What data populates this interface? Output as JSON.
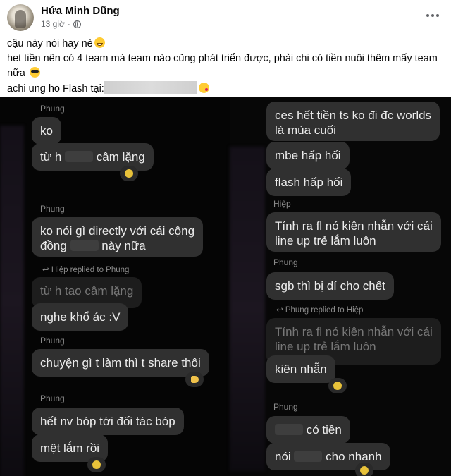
{
  "post": {
    "author": "Hứa Minh Dũng",
    "time": "13 giờ",
    "lines": [
      "cậu này nói hay nè",
      "het tiền nên có 4 team mà team nào cũng phát triển được, phải chi có tiền nuôi thêm mấy team",
      "nữa",
      "achi ung ho Flash tại:"
    ],
    "icons": [
      "globe-icon",
      "more-options-icon",
      "grin-emoji",
      "sunglasses-emoji",
      "kiss-emoji"
    ]
  },
  "chat_left": {
    "s1": "Phung",
    "b1": "ko",
    "b2a": "từ h",
    "b2b": "câm lặng",
    "s2": "Phung",
    "b3l1": "ko nói gì directly với cái cộng",
    "b3l2a": "đồng",
    "b3l2b": "này nữa",
    "reply1": "↩ Hiệp replied to Phung",
    "quote1": "từ h tao câm lặng",
    "b4": "nghe khổ ác :V",
    "s3": "Phung",
    "b5": "chuyện gì t làm thì t share thôi",
    "s4": "Phung",
    "b6": "hết nv bóp tới đối tác bóp",
    "b7": "mệt lắm rồi"
  },
  "chat_right": {
    "b1l1": "ces hết tiền ts ko đi đc worlds",
    "b1l2": "là mùa cuối",
    "b2": "mbe hấp hối",
    "b3": "flash hấp hối",
    "s1": "Hiệp",
    "b4l1": "Tính ra fl nó kiên nhẫn với cái",
    "b4l2": "line up trẻ lắm luôn",
    "s2": "Phung",
    "b5": "sgb thì bị dí cho chết",
    "reply1": "↩ Phung replied to Hiệp",
    "quote1l1": "Tính ra fl nó kiên nhẫn với cái",
    "quote1l2": "line up trẻ lắm luôn",
    "b6": "kiên nhẫn",
    "s3": "Phung",
    "b7": "có tiền",
    "b8a": "nói",
    "b8b": "cho nhanh"
  }
}
